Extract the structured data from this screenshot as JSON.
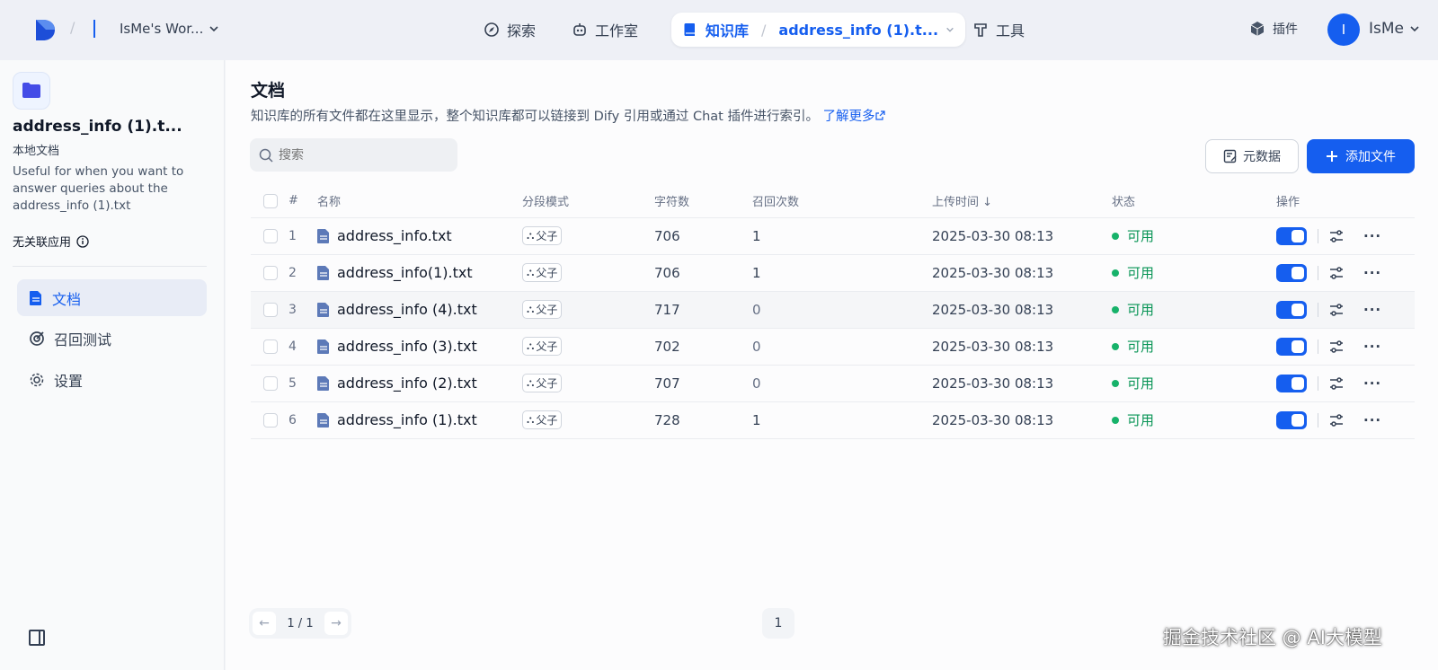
{
  "header": {
    "workspace": "IsMe's Wor...",
    "nav": [
      {
        "label": "探索",
        "icon": "compass-icon"
      },
      {
        "label": "工作室",
        "icon": "robot-icon"
      },
      {
        "label": "工具",
        "icon": "hammer-icon"
      }
    ],
    "active_nav": {
      "label": "知识库",
      "sub": "address_info (1).t..."
    },
    "plugin_label": "插件",
    "user_initial": "I",
    "user_name": "IsMe"
  },
  "sidebar": {
    "title": "address_info (1).t...",
    "type": "本地文档",
    "description": "Useful for when you want to answer queries about the address_info (1).txt",
    "apps": "无关联应用",
    "items": [
      {
        "label": "文档",
        "icon": "document-icon",
        "active": true
      },
      {
        "label": "召回测试",
        "icon": "target-icon",
        "active": false
      },
      {
        "label": "设置",
        "icon": "gear-icon",
        "active": false
      }
    ]
  },
  "main": {
    "title": "文档",
    "description": "知识库的所有文件都在这里显示，整个知识库都可以链接到 Dify 引用或通过 Chat 插件进行索引。",
    "learn_more": "了解更多",
    "search_placeholder": "搜索",
    "meta_button": "元数据",
    "add_button": "添加文件",
    "columns": [
      "#",
      "名称",
      "分段模式",
      "字符数",
      "召回次数",
      "上传时间 ↓",
      "状态",
      "操作"
    ],
    "rows": [
      {
        "num": "1",
        "name": "address_info.txt",
        "mode": "父子",
        "chars": "706",
        "hits": "1",
        "uploaded": "2025-03-30 08:13",
        "status": "可用"
      },
      {
        "num": "2",
        "name": "address_info(1).txt",
        "mode": "父子",
        "chars": "706",
        "hits": "1",
        "uploaded": "2025-03-30 08:13",
        "status": "可用"
      },
      {
        "num": "3",
        "name": "address_info (4).txt",
        "mode": "父子",
        "chars": "717",
        "hits": "0",
        "uploaded": "2025-03-30 08:13",
        "status": "可用"
      },
      {
        "num": "4",
        "name": "address_info (3).txt",
        "mode": "父子",
        "chars": "702",
        "hits": "0",
        "uploaded": "2025-03-30 08:13",
        "status": "可用"
      },
      {
        "num": "5",
        "name": "address_info (2).txt",
        "mode": "父子",
        "chars": "707",
        "hits": "0",
        "uploaded": "2025-03-30 08:13",
        "status": "可用"
      },
      {
        "num": "6",
        "name": "address_info (1).txt",
        "mode": "父子",
        "chars": "728",
        "hits": "1",
        "uploaded": "2025-03-30 08:13",
        "status": "可用"
      }
    ],
    "pagination": {
      "count": "1 / 1",
      "page": "1"
    }
  },
  "watermark": "掘金技术社区 @ AI大模型",
  "colors": {
    "accent": "#155eef",
    "status_ok": "#17b26a"
  }
}
